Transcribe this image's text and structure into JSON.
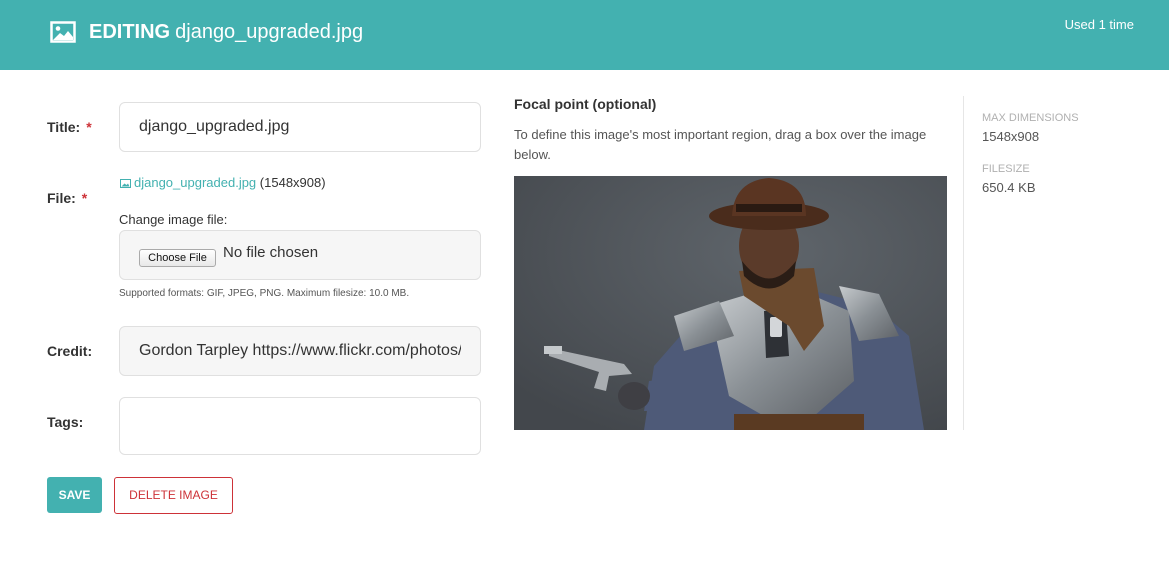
{
  "header": {
    "label": "EDITING",
    "filename": "django_upgraded.jpg",
    "usage": "Used 1 time",
    "color": "#43b1b0"
  },
  "form": {
    "title_label": "Title:",
    "title_required": "*",
    "title_value": "django_upgraded.jpg",
    "file_label": "File:",
    "file_required": "*",
    "file_link": "django_upgraded.jpg",
    "file_dims": "(1548x908)",
    "change_label": "Change image file:",
    "choose_button": "Choose File",
    "no_file": "No file chosen",
    "help_text": "Supported formats: GIF, JPEG, PNG. Maximum filesize: 10.0 MB.",
    "credit_label": "Credit:",
    "credit_value": "Gordon Tarpley https://www.flickr.com/photos/",
    "tags_label": "Tags:",
    "tags_value": ""
  },
  "actions": {
    "save": "SAVE",
    "delete": "DELETE IMAGE"
  },
  "focal": {
    "title": "Focal point (optional)",
    "help": "To define this image's most important region, drag a box over the image below."
  },
  "meta": {
    "max_dimensions_label": "MAX DIMENSIONS",
    "max_dimensions_value": "1548x908",
    "filesize_label": "FILESIZE",
    "filesize_value": "650.4 KB"
  }
}
